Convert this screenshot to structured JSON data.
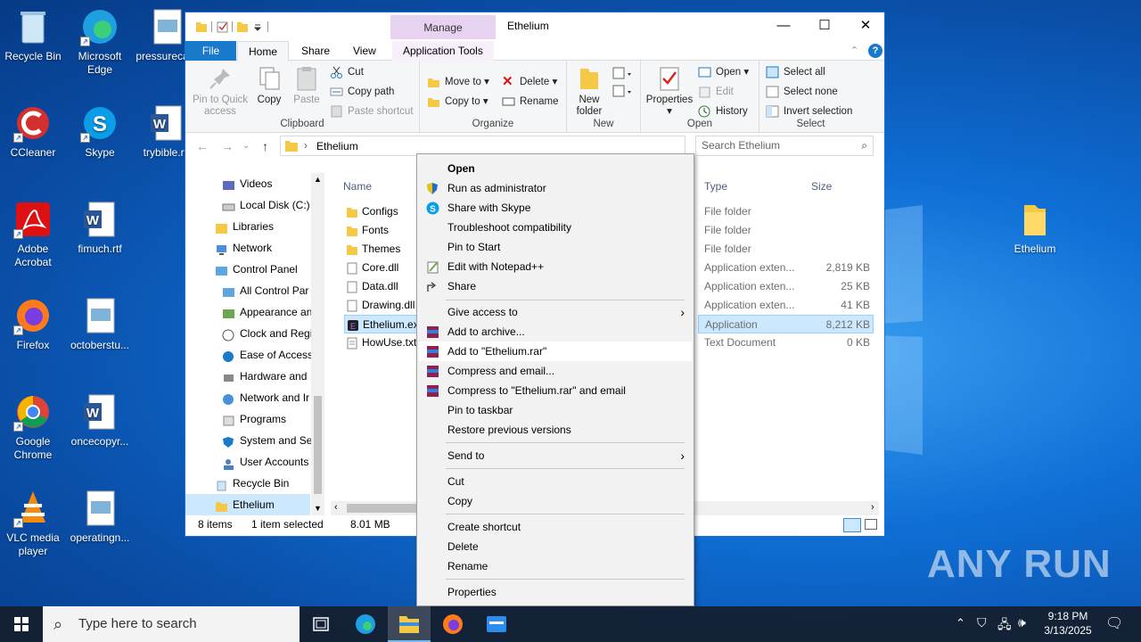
{
  "desktop": {
    "icons": [
      {
        "label": "Recycle Bin"
      },
      {
        "label": "Microsoft Edge"
      },
      {
        "label": "pressureca..."
      },
      {
        "label": "CCleaner"
      },
      {
        "label": "Skype"
      },
      {
        "label": "trybible.rtf"
      },
      {
        "label": "Adobe Acrobat"
      },
      {
        "label": "fimuch.rtf"
      },
      {
        "label": "Firefox"
      },
      {
        "label": "octoberstu..."
      },
      {
        "label": "Google Chrome"
      },
      {
        "label": "oncecopyr..."
      },
      {
        "label": "VLC media player"
      },
      {
        "label": "operatingn..."
      },
      {
        "label": "Ethelium"
      }
    ],
    "watermark": "ANY RUN"
  },
  "explorer": {
    "title": "Ethelium",
    "manage_tab": "Manage",
    "tabs": [
      "File",
      "Home",
      "Share",
      "View",
      "Application Tools"
    ],
    "ribbon": {
      "clipboard": {
        "label": "Clipboard",
        "pin": "Pin to Quick access",
        "copy": "Copy",
        "paste": "Paste",
        "cut": "Cut",
        "copy_path": "Copy path",
        "paste_shortcut": "Paste shortcut"
      },
      "organize": {
        "label": "Organize",
        "move_to": "Move to",
        "copy_to": "Copy to",
        "delete": "Delete",
        "rename": "Rename"
      },
      "new": {
        "label": "New",
        "new_folder": "New folder"
      },
      "open": {
        "label": "Open",
        "properties": "Properties",
        "open": "Open",
        "edit": "Edit",
        "history": "History"
      },
      "select": {
        "label": "Select",
        "select_all": "Select all",
        "select_none": "Select none",
        "invert": "Invert selection"
      }
    },
    "address": {
      "path": "Ethelium",
      "search_placeholder": "Search Ethelium"
    },
    "nav": [
      "Videos",
      "Local Disk (C:)",
      "Libraries",
      "Network",
      "Control Panel",
      "All Control Par",
      "Appearance an",
      "Clock and Regi",
      "Ease of Access",
      "Hardware and",
      "Network and Ir",
      "Programs",
      "System and Se",
      "User Accounts",
      "Recycle Bin",
      "Ethelium"
    ],
    "columns": {
      "name": "Name",
      "type": "Type",
      "size": "Size"
    },
    "files": [
      {
        "name": "Configs",
        "type": "File folder",
        "size": ""
      },
      {
        "name": "Fonts",
        "type": "File folder",
        "size": ""
      },
      {
        "name": "Themes",
        "type": "File folder",
        "size": ""
      },
      {
        "name": "Core.dll",
        "type": "Application exten...",
        "size": "2,819 KB"
      },
      {
        "name": "Data.dll",
        "type": "Application exten...",
        "size": "25 KB"
      },
      {
        "name": "Drawing.dll",
        "type": "Application exten...",
        "size": "41 KB"
      },
      {
        "name": "Ethelium.exe",
        "type": "Application",
        "size": "8,212 KB"
      },
      {
        "name": "HowUse.txt",
        "type": "Text Document",
        "size": "0 KB"
      }
    ],
    "status": {
      "count": "8 items",
      "selected": "1 item selected",
      "size": "8.01 MB"
    }
  },
  "context_menu": {
    "items": [
      "Open",
      "Run as administrator",
      "Share with Skype",
      "Troubleshoot compatibility",
      "Pin to Start",
      "Edit with Notepad++",
      "Share",
      "Give access to",
      "Add to archive...",
      "Add to \"Ethelium.rar\"",
      "Compress and email...",
      "Compress to \"Ethelium.rar\" and email",
      "Pin to taskbar",
      "Restore previous versions",
      "Send to",
      "Cut",
      "Copy",
      "Create shortcut",
      "Delete",
      "Rename",
      "Properties"
    ]
  },
  "taskbar": {
    "search_placeholder": "Type here to search",
    "time": "9:18 PM",
    "date": "3/13/2025"
  }
}
